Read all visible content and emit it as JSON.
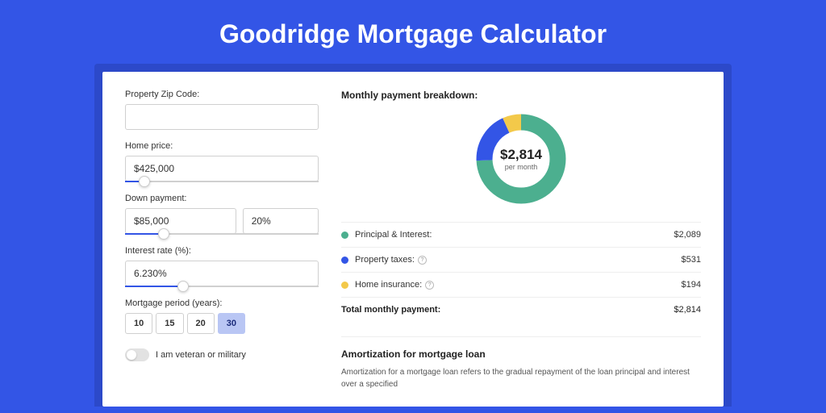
{
  "title": "Goodridge Mortgage Calculator",
  "form": {
    "zip_label": "Property Zip Code:",
    "zip_value": "",
    "home_price_label": "Home price:",
    "home_price_value": "$425,000",
    "down_payment_label": "Down payment:",
    "down_payment_amount": "$85,000",
    "down_payment_pct": "20%",
    "interest_label": "Interest rate (%):",
    "interest_value": "6.230%",
    "period_label": "Mortgage period (years):",
    "period_options": [
      "10",
      "15",
      "20",
      "30"
    ],
    "period_selected": "30",
    "veteran_label": "I am veteran or military"
  },
  "breakdown": {
    "title": "Monthly payment breakdown:",
    "donut_amount": "$2,814",
    "donut_sub": "per month",
    "items": [
      {
        "label": "Principal & Interest:",
        "value": "$2,089",
        "color": "#4caf8f",
        "has_info": false
      },
      {
        "label": "Property taxes:",
        "value": "$531",
        "color": "#3355e6",
        "has_info": true
      },
      {
        "label": "Home insurance:",
        "value": "$194",
        "color": "#f3c94a",
        "has_info": true
      }
    ],
    "total_label": "Total monthly payment:",
    "total_value": "$2,814"
  },
  "amortization": {
    "title": "Amortization for mortgage loan",
    "text": "Amortization for a mortgage loan refers to the gradual repayment of the loan principal and interest over a specified"
  },
  "chart_data": {
    "type": "pie",
    "title": "Monthly payment breakdown",
    "series": [
      {
        "name": "Principal & Interest",
        "value": 2089,
        "color": "#4caf8f"
      },
      {
        "name": "Property taxes",
        "value": 531,
        "color": "#3355e6"
      },
      {
        "name": "Home insurance",
        "value": 194,
        "color": "#f3c94a"
      }
    ],
    "total": 2814
  }
}
